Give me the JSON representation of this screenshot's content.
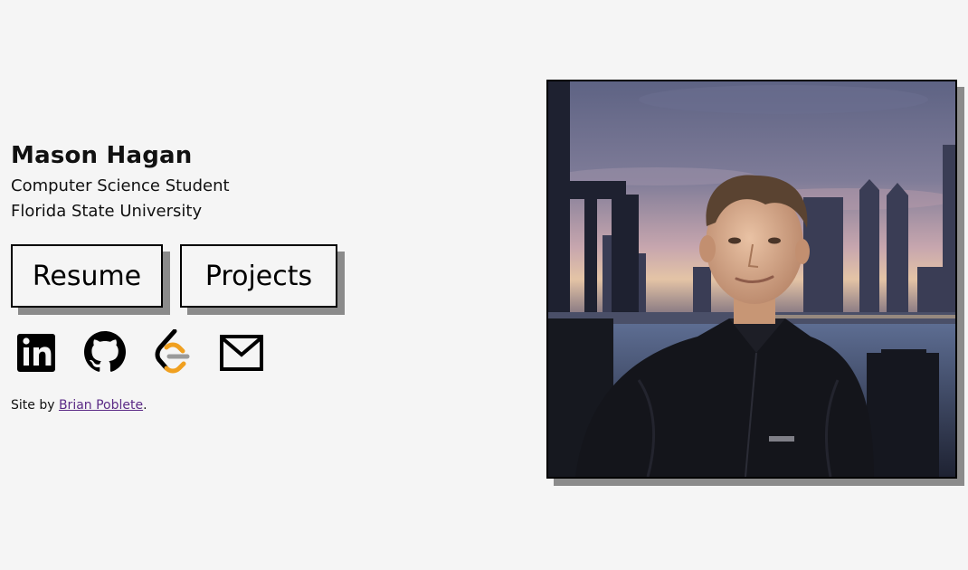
{
  "profile": {
    "name": "Mason Hagan",
    "role": "Computer Science Student",
    "school": "Florida State University"
  },
  "buttons": {
    "resume": "Resume",
    "projects": "Projects"
  },
  "socials": [
    {
      "icon": "linkedin-icon"
    },
    {
      "icon": "github-icon"
    },
    {
      "icon": "leetcode-icon"
    },
    {
      "icon": "email-icon"
    }
  ],
  "credit": {
    "prefix": "Site by ",
    "link_text": "Brian Poblete",
    "suffix": "."
  },
  "colors": {
    "background": "#f5f5f5",
    "shadow": "#8b8b8b",
    "link": "#5b2a86",
    "leetcode_orange": "#f0a020"
  }
}
